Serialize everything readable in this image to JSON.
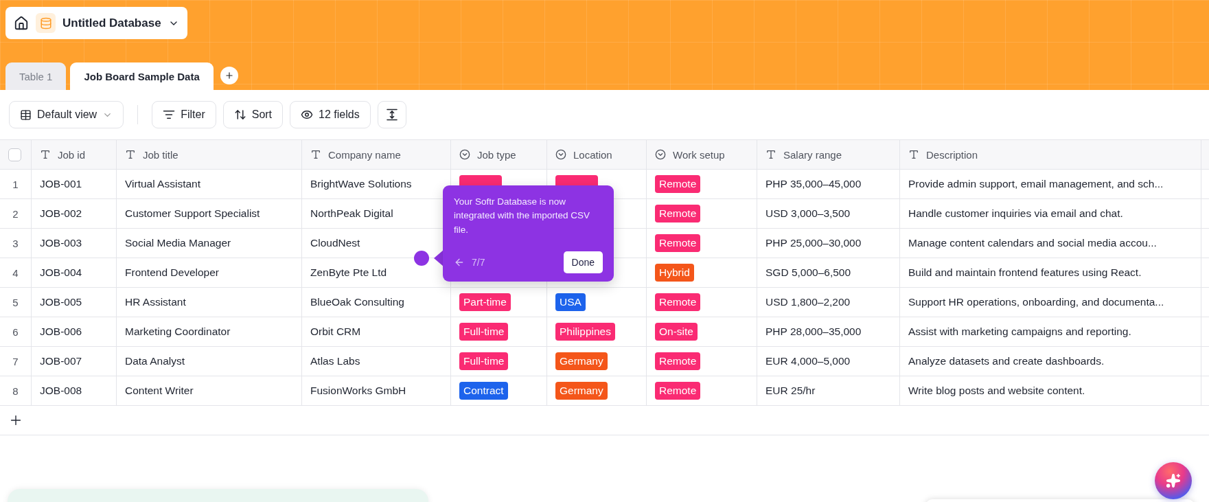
{
  "database": {
    "title": "Untitled Database"
  },
  "tabs": [
    {
      "label": "Table 1",
      "selected": false
    },
    {
      "label": "Job Board Sample Data",
      "selected": true
    }
  ],
  "toolbar": {
    "view": "Default view",
    "buttons": [
      {
        "kind": "filter",
        "label": "Filter"
      },
      {
        "kind": "sort",
        "label": "Sort"
      },
      {
        "kind": "fields",
        "label": "12 fields"
      },
      {
        "kind": "row-height"
      }
    ]
  },
  "table": {
    "select_all": {
      "checked": false
    },
    "columns": [
      {
        "label": "Job id",
        "kind": "text"
      },
      {
        "label": "Job title",
        "kind": "text"
      },
      {
        "label": "Company name",
        "kind": "text"
      },
      {
        "label": "Job type",
        "kind": "select"
      },
      {
        "label": "Location",
        "kind": "select"
      },
      {
        "label": "Work setup",
        "kind": "select"
      },
      {
        "label": "Salary range",
        "kind": "text"
      },
      {
        "label": "Description",
        "kind": "text"
      }
    ],
    "rows": [
      {
        "number": "1",
        "job_id": "JOB-001",
        "job_title": "Virtual Assistant",
        "company": "BrightWave Solutions",
        "job_type": {
          "color": "#fa2b73"
        },
        "location": {
          "color": "#fa2b73"
        },
        "work_setup": {
          "label": "Remote",
          "color": "#fa2b73"
        },
        "salary": "PHP 35,000–45,000",
        "description": "Provide admin support, email management, and sch..."
      },
      {
        "number": "2",
        "job_id": "JOB-002",
        "job_title": "Customer Support Specialist",
        "company": "NorthPeak Digital",
        "work_setup": {
          "label": "Remote",
          "color": "#fa2b73"
        },
        "salary": "USD 3,000–3,500",
        "description": "Handle customer inquiries via email and chat."
      },
      {
        "number": "3",
        "job_id": "JOB-003",
        "job_title": "Social Media Manager",
        "company": "CloudNest",
        "work_setup": {
          "label": "Remote",
          "color": "#fa2b73"
        },
        "salary": "PHP 25,000–30,000",
        "description": "Manage content calendars and social media accou..."
      },
      {
        "number": "4",
        "job_id": "JOB-004",
        "job_title": "Frontend Developer",
        "company": "ZenByte Pte Ltd",
        "work_setup": {
          "label": "Hybrid",
          "color": "#f4561a"
        },
        "salary": "SGD 5,000–6,500",
        "description": "Build and maintain frontend features using React."
      },
      {
        "number": "5",
        "job_id": "JOB-005",
        "job_title": "HR Assistant",
        "company": "BlueOak Consulting",
        "job_type": {
          "label": "Part-time",
          "color": "#fa2b73"
        },
        "location": {
          "label": "USA",
          "color": "#1d63ec"
        },
        "work_setup": {
          "label": "Remote",
          "color": "#fa2b73"
        },
        "salary": "USD 1,800–2,200",
        "description": "Support HR operations, onboarding, and documenta..."
      },
      {
        "number": "6",
        "job_id": "JOB-006",
        "job_title": "Marketing Coordinator",
        "company": "Orbit CRM",
        "job_type": {
          "label": "Full-time",
          "color": "#fa2b73"
        },
        "location": {
          "label": "Philippines",
          "color": "#fa2b73"
        },
        "work_setup": {
          "label": "On-site",
          "color": "#fa2b73"
        },
        "salary": "PHP 28,000–35,000",
        "description": "Assist with marketing campaigns and reporting."
      },
      {
        "number": "7",
        "job_id": "JOB-007",
        "job_title": "Data Analyst",
        "company": "Atlas Labs",
        "job_type": {
          "label": "Full-time",
          "color": "#fa2b73"
        },
        "location": {
          "label": "Germany",
          "color": "#f4561a"
        },
        "work_setup": {
          "label": "Remote",
          "color": "#fa2b73"
        },
        "salary": "EUR 4,000–5,000",
        "description": "Analyze datasets and create dashboards."
      },
      {
        "number": "8",
        "job_id": "JOB-008",
        "job_title": "Content Writer",
        "company": "FusionWorks GmbH",
        "job_type": {
          "label": "Contract",
          "color": "#1d63ec"
        },
        "location": {
          "label": "Germany",
          "color": "#f4561a"
        },
        "work_setup": {
          "label": "Remote",
          "color": "#fa2b73"
        },
        "salary": "EUR 25/hr",
        "description": "Write blog posts and website content."
      }
    ]
  },
  "tour": {
    "message": "Your Softr Database is now integrated with the imported CSV file.",
    "step": "7/7",
    "button": "Done"
  }
}
